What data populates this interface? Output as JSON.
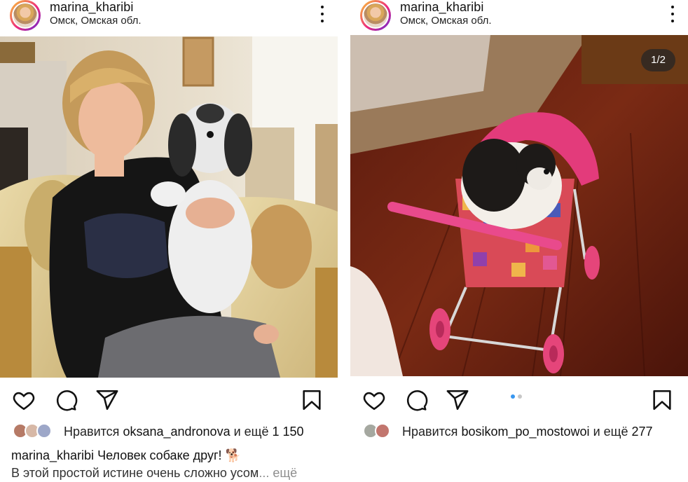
{
  "posts": [
    {
      "username": "marina_kharibi",
      "location": "Омск, Омская обл.",
      "likes_prefix": "Нравится",
      "likes_user": "oksana_andronova",
      "likes_and": "и ещё",
      "likes_count": "1 150",
      "caption_user": "marina_kharibi",
      "caption_text": "Человек собаке друг! 🐕",
      "caption_line2": "В этой простой истине очень сложно усом",
      "ellipsis": "...",
      "more_label": "ещё"
    },
    {
      "username": "marina_kharibi",
      "location": "Омск, Омская обл.",
      "counter": "1/2",
      "likes_prefix": "Нравится",
      "likes_user": "bosikom_po_mostowoi",
      "likes_and": "и ещё",
      "likes_count": "277",
      "carousel_index": 0,
      "carousel_total": 2
    }
  ],
  "icons": [
    "heart-icon",
    "comment-icon",
    "share-icon",
    "bookmark-icon",
    "more-options-icon"
  ],
  "colors": {
    "active_dot": "#3897f0",
    "inactive_dot": "#c7c7c7",
    "text": "#111111",
    "muted": "#8e8e8e"
  }
}
